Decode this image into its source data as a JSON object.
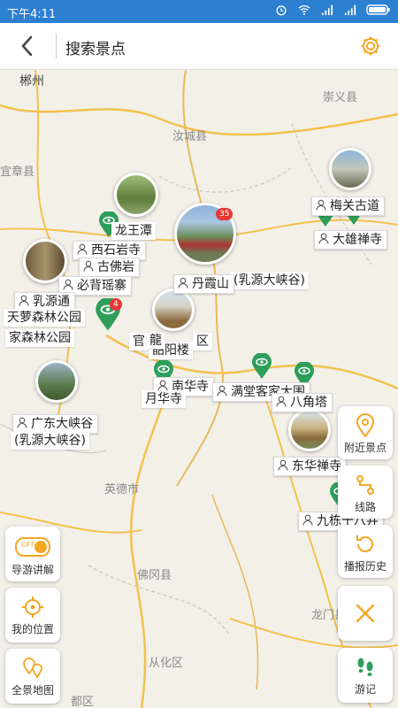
{
  "status": {
    "time": "下午4:11"
  },
  "header": {
    "title": "搜索景点"
  },
  "colors": {
    "accent": "#f5a623",
    "pin": "#2e9e5b",
    "statusbar": "#2d7fd0",
    "road": "#f2c14e"
  },
  "map": {
    "places": [
      "郴州",
      "崇义县",
      "汝城县",
      "宜章县",
      "英德市",
      "佛冈县",
      "龙门县",
      "从化区",
      "都区"
    ],
    "spots": [
      "龙王潭",
      "西石岩寺",
      "古佛岩",
      "必背瑶寨",
      "乳源通",
      "天萝森林公园",
      "家森林公园",
      "丹霞山",
      "韶阳楼",
      "南华寺",
      "月华寺",
      "满堂客家大围",
      "八角塔",
      "东华禅寺",
      "九栋十八井",
      "梅关古道",
      "大雄禅寺",
      "广东大峡谷",
      "(乳源大峡谷)",
      "区",
      "官",
      "龍"
    ],
    "badges": [
      "35",
      "4"
    ]
  },
  "buttons": {
    "nearby": "附近景点",
    "route": "线路",
    "history": "播报历史",
    "tour": "导游讲解",
    "toggle": "OFF",
    "location": "我的位置",
    "panorama": "全景地图",
    "journal": "游记"
  }
}
